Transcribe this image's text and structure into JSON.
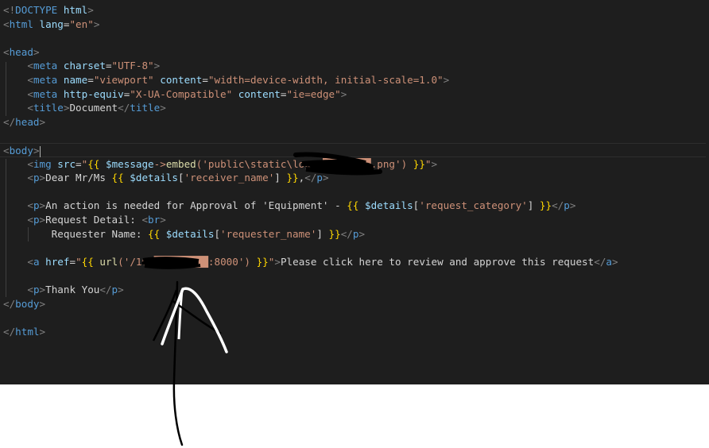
{
  "editor": {
    "theme": "dark",
    "colors": {
      "background": "#1e1e1e",
      "tag": "#569cd6",
      "attribute": "#9cdcfe",
      "string": "#ce9178",
      "text": "#d4d4d4",
      "brace": "#ffd700",
      "punctuation": "#808080"
    },
    "lines": [
      {
        "tokens": [
          [
            "br",
            "<!"
          ],
          [
            "tag",
            "DOCTYPE"
          ],
          [
            "txt",
            " "
          ],
          [
            "attr",
            "html"
          ],
          [
            "br",
            ">"
          ]
        ]
      },
      {
        "tokens": [
          [
            "br",
            "<"
          ],
          [
            "tag",
            "html"
          ],
          [
            "txt",
            " "
          ],
          [
            "attr",
            "lang"
          ],
          [
            "txt",
            "="
          ],
          [
            "str",
            "\"en\""
          ],
          [
            "br",
            ">"
          ]
        ]
      },
      {
        "tokens": []
      },
      {
        "tokens": [
          [
            "br",
            "<"
          ],
          [
            "tag",
            "head"
          ],
          [
            "br",
            ">"
          ]
        ]
      },
      {
        "indent": 1,
        "tokens": [
          [
            "br",
            "<"
          ],
          [
            "tag",
            "meta"
          ],
          [
            "txt",
            " "
          ],
          [
            "attr",
            "charset"
          ],
          [
            "txt",
            "="
          ],
          [
            "str",
            "\"UTF-8\""
          ],
          [
            "br",
            ">"
          ]
        ]
      },
      {
        "indent": 1,
        "tokens": [
          [
            "br",
            "<"
          ],
          [
            "tag",
            "meta"
          ],
          [
            "txt",
            " "
          ],
          [
            "attr",
            "name"
          ],
          [
            "txt",
            "="
          ],
          [
            "str",
            "\"viewport\""
          ],
          [
            "txt",
            " "
          ],
          [
            "attr",
            "content"
          ],
          [
            "txt",
            "="
          ],
          [
            "str",
            "\"width=device-width, initial-scale=1.0\""
          ],
          [
            "br",
            ">"
          ]
        ]
      },
      {
        "indent": 1,
        "tokens": [
          [
            "br",
            "<"
          ],
          [
            "tag",
            "meta"
          ],
          [
            "txt",
            " "
          ],
          [
            "attr",
            "http-equiv"
          ],
          [
            "txt",
            "="
          ],
          [
            "str",
            "\"X-UA-Compatible\""
          ],
          [
            "txt",
            " "
          ],
          [
            "attr",
            "content"
          ],
          [
            "txt",
            "="
          ],
          [
            "str",
            "\"ie=edge\""
          ],
          [
            "br",
            ">"
          ]
        ]
      },
      {
        "indent": 1,
        "tokens": [
          [
            "br",
            "<"
          ],
          [
            "tag",
            "title"
          ],
          [
            "br",
            ">"
          ],
          [
            "txt",
            "Document"
          ],
          [
            "br",
            "</"
          ],
          [
            "tag",
            "title"
          ],
          [
            "br",
            ">"
          ]
        ]
      },
      {
        "tokens": [
          [
            "br",
            "</"
          ],
          [
            "tag",
            "head"
          ],
          [
            "br",
            ">"
          ]
        ]
      },
      {
        "tokens": []
      },
      {
        "current": true,
        "tokens": [
          [
            "br",
            "<"
          ],
          [
            "tag",
            "body"
          ],
          [
            "br",
            ">"
          ],
          [
            "cursor",
            ""
          ]
        ]
      },
      {
        "indent": 1,
        "tokens": [
          [
            "br",
            "<"
          ],
          [
            "tag",
            "img"
          ],
          [
            "txt",
            " "
          ],
          [
            "attr",
            "src"
          ],
          [
            "txt",
            "="
          ],
          [
            "str",
            "\""
          ],
          [
            "brace",
            "{{"
          ],
          [
            "str",
            " "
          ],
          [
            "var",
            "$message"
          ],
          [
            "str",
            "->"
          ],
          [
            "fn",
            "embed"
          ],
          [
            "str",
            "('public\\static\\logo\\"
          ],
          [
            "str",
            "████████"
          ],
          [
            "str",
            ".png') "
          ],
          [
            "brace",
            "}}"
          ],
          [
            "str",
            "\""
          ],
          [
            "br",
            ">"
          ]
        ]
      },
      {
        "indent": 1,
        "tokens": [
          [
            "br",
            "<"
          ],
          [
            "tag",
            "p"
          ],
          [
            "br",
            ">"
          ],
          [
            "txt",
            "Dear Mr/Ms "
          ],
          [
            "brace",
            "{{"
          ],
          [
            "txt",
            " "
          ],
          [
            "var",
            "$details"
          ],
          [
            "txt",
            "["
          ],
          [
            "str",
            "'receiver_name'"
          ],
          [
            "txt",
            "] "
          ],
          [
            "brace",
            "}}"
          ],
          [
            "txt",
            ","
          ],
          [
            "br",
            "</"
          ],
          [
            "tag",
            "p"
          ],
          [
            "br",
            ">"
          ]
        ]
      },
      {
        "tokens": []
      },
      {
        "indent": 1,
        "tokens": [
          [
            "br",
            "<"
          ],
          [
            "tag",
            "p"
          ],
          [
            "br",
            ">"
          ],
          [
            "txt",
            "An action is needed for Approval of 'Equipment' - "
          ],
          [
            "brace",
            "{{"
          ],
          [
            "txt",
            " "
          ],
          [
            "var",
            "$details"
          ],
          [
            "txt",
            "["
          ],
          [
            "str",
            "'request_category'"
          ],
          [
            "txt",
            "] "
          ],
          [
            "brace",
            "}}"
          ],
          [
            "br",
            "</"
          ],
          [
            "tag",
            "p"
          ],
          [
            "br",
            ">"
          ]
        ]
      },
      {
        "indent": 1,
        "tokens": [
          [
            "br",
            "<"
          ],
          [
            "tag",
            "p"
          ],
          [
            "br",
            ">"
          ],
          [
            "txt",
            "Request Detail: "
          ],
          [
            "br",
            "<"
          ],
          [
            "tag",
            "br"
          ],
          [
            "br",
            ">"
          ]
        ]
      },
      {
        "indent": 2,
        "tokens": [
          [
            "txt",
            "Requester Name: "
          ],
          [
            "brace",
            "{{"
          ],
          [
            "txt",
            " "
          ],
          [
            "var",
            "$details"
          ],
          [
            "txt",
            "["
          ],
          [
            "str",
            "'requester_name'"
          ],
          [
            "txt",
            "] "
          ],
          [
            "brace",
            "}}"
          ],
          [
            "br",
            "</"
          ],
          [
            "tag",
            "p"
          ],
          [
            "br",
            ">"
          ]
        ]
      },
      {
        "tokens": []
      },
      {
        "indent": 1,
        "tokens": [
          [
            "br",
            "<"
          ],
          [
            "tag",
            "a"
          ],
          [
            "txt",
            " "
          ],
          [
            "attr",
            "href"
          ],
          [
            "txt",
            "="
          ],
          [
            "str",
            "\""
          ],
          [
            "brace",
            "{{"
          ],
          [
            "str",
            " "
          ],
          [
            "fn",
            "url"
          ],
          [
            "str",
            "('/10."
          ],
          [
            "str",
            "█████████"
          ],
          [
            "str",
            ":8000') "
          ],
          [
            "brace",
            "}}"
          ],
          [
            "str",
            "\""
          ],
          [
            "br",
            ">"
          ],
          [
            "txt",
            "Please click here to review and approve this request"
          ],
          [
            "br",
            "</"
          ],
          [
            "tag",
            "a"
          ],
          [
            "br",
            ">"
          ]
        ]
      },
      {
        "tokens": []
      },
      {
        "indent": 1,
        "tokens": [
          [
            "br",
            "<"
          ],
          [
            "tag",
            "p"
          ],
          [
            "br",
            ">"
          ],
          [
            "txt",
            "Thank You"
          ],
          [
            "br",
            "</"
          ],
          [
            "tag",
            "p"
          ],
          [
            "br",
            ">"
          ]
        ]
      },
      {
        "tokens": [
          [
            "br",
            "</"
          ],
          [
            "tag",
            "body"
          ],
          [
            "br",
            ">"
          ]
        ]
      },
      {
        "tokens": []
      },
      {
        "tokens": [
          [
            "br",
            "</"
          ],
          [
            "tag",
            "html"
          ],
          [
            "br",
            ">"
          ]
        ]
      }
    ]
  },
  "annotations": {
    "redactions": [
      "logo-filename",
      "ip-address"
    ],
    "drawn_arrow": "hand-drawn arrow pointing up at the href url"
  }
}
